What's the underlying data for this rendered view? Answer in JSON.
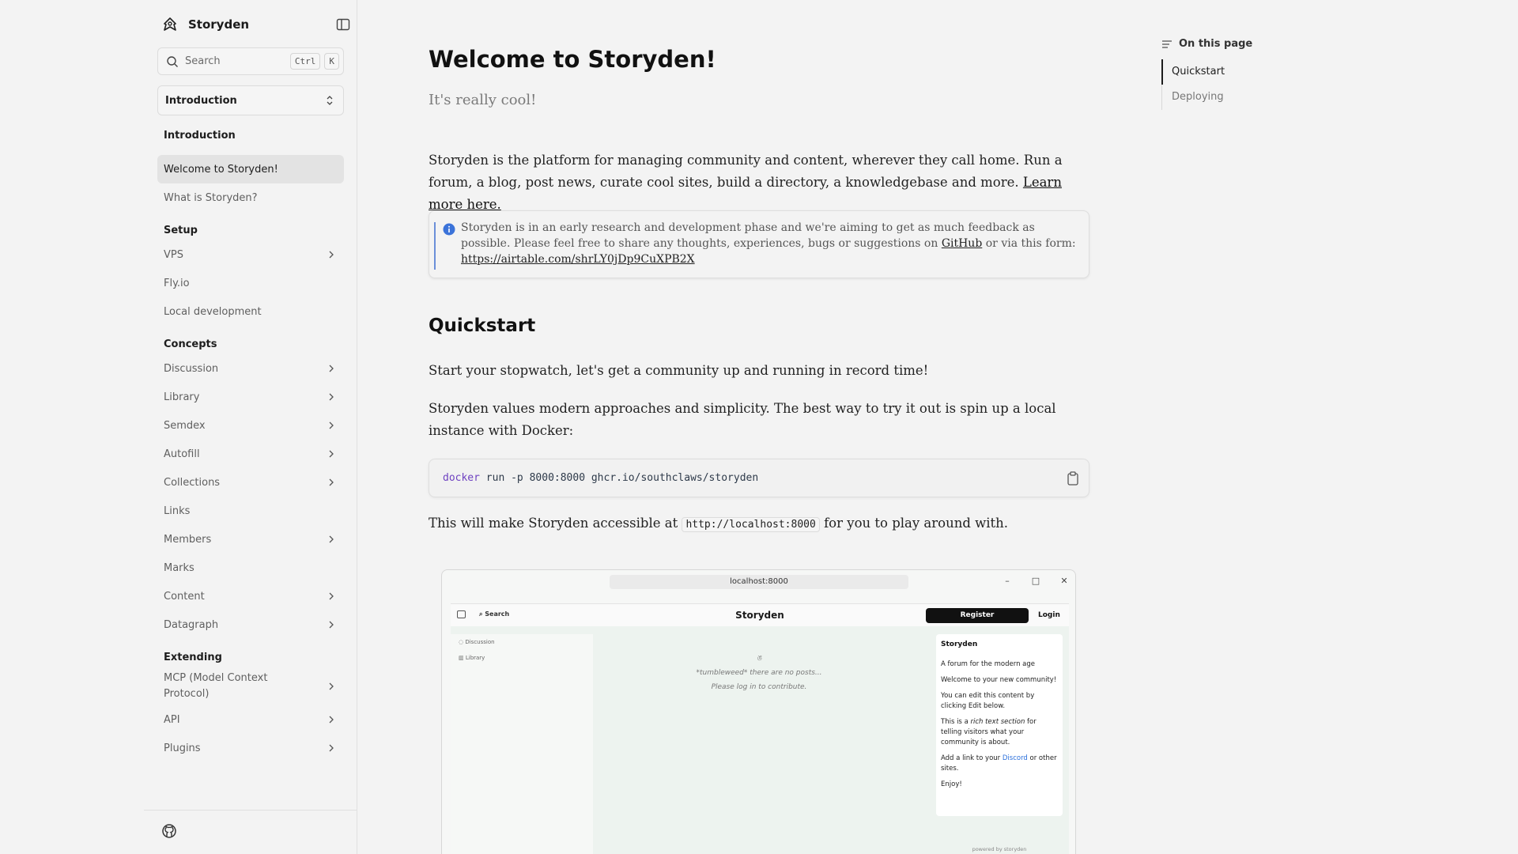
{
  "brand": {
    "name": "Storyden"
  },
  "search": {
    "placeholder": "Search",
    "key1": "Ctrl",
    "key2": "K"
  },
  "version_select": {
    "value": "Introduction"
  },
  "sidebar": {
    "introduction": {
      "title": "Introduction",
      "items": [
        "Welcome to Storyden!",
        "What is Storyden?"
      ]
    },
    "setup": {
      "title": "Setup",
      "items": [
        "VPS",
        "Fly.io",
        "Local development"
      ]
    },
    "concepts": {
      "title": "Concepts",
      "items": [
        "Discussion",
        "Library",
        "Semdex",
        "Autofill",
        "Collections",
        "Links",
        "Members",
        "Marks",
        "Content",
        "Datagraph"
      ]
    },
    "extending": {
      "title": "Extending",
      "items": [
        "MCP (Model Context Protocol)",
        "API",
        "Plugins"
      ]
    }
  },
  "page": {
    "title": "Welcome to Storyden!",
    "subtitle": "It's really cool!",
    "intro": "Storyden is the platform for managing community and content, wherever they call home. Run a forum, a blog, post news, curate cool sites, build a directory, a knowledgebase and more.",
    "intro_link": "Learn more here.",
    "callout_text": "Storyden is in an early research and development phase and we're aiming to get as much feedback as possible. Please feel free to share any thoughts, experiences, bugs or suggestions on",
    "callout_link_github": "GitHub",
    "callout_mid": "or via this form:",
    "callout_link_form": "https://airtable.com/shrLY0jDp9CuXPB2X",
    "quickstart_title": "Quickstart",
    "quickstart_p1": "Start your stopwatch, let's get a community up and running in record time!",
    "quickstart_p2": "Storyden values modern approaches and simplicity. The best way to try it out is spin up a local instance with Docker:",
    "code_kw": "docker",
    "code_rest": "run -p 8000:8000 ghcr.io/southclaws/storyden",
    "access_before": "This will make Storyden accessible at",
    "access_code": "http://localhost:8000",
    "access_after": "for you to play around with."
  },
  "screenshot": {
    "url": "localhost:8000",
    "search": "Search",
    "title": "Storyden",
    "register": "Register",
    "login": "Login",
    "nav": [
      "Discussion",
      "Library"
    ],
    "empty_line1": "*tumbleweed* there are no posts...",
    "empty_line2": "Please log in to contribute.",
    "card_title": "Storyden",
    "card_p1": "A forum for the modern age",
    "card_p2": "Welcome to your new community!",
    "card_p3": "You can edit this content by clicking Edit below.",
    "card_p4_a": "This is a",
    "card_p4_em": "rich text section",
    "card_p4_b": "for telling visitors what your community is about.",
    "card_p5_a": "Add a link to your",
    "card_p5_link": "Discord",
    "card_p5_b": "or other sites.",
    "card_p6": "Enjoy!",
    "powered": "powered by storyden"
  },
  "toc": {
    "title": "On this page",
    "items": [
      "Quickstart",
      "Deploying"
    ]
  }
}
